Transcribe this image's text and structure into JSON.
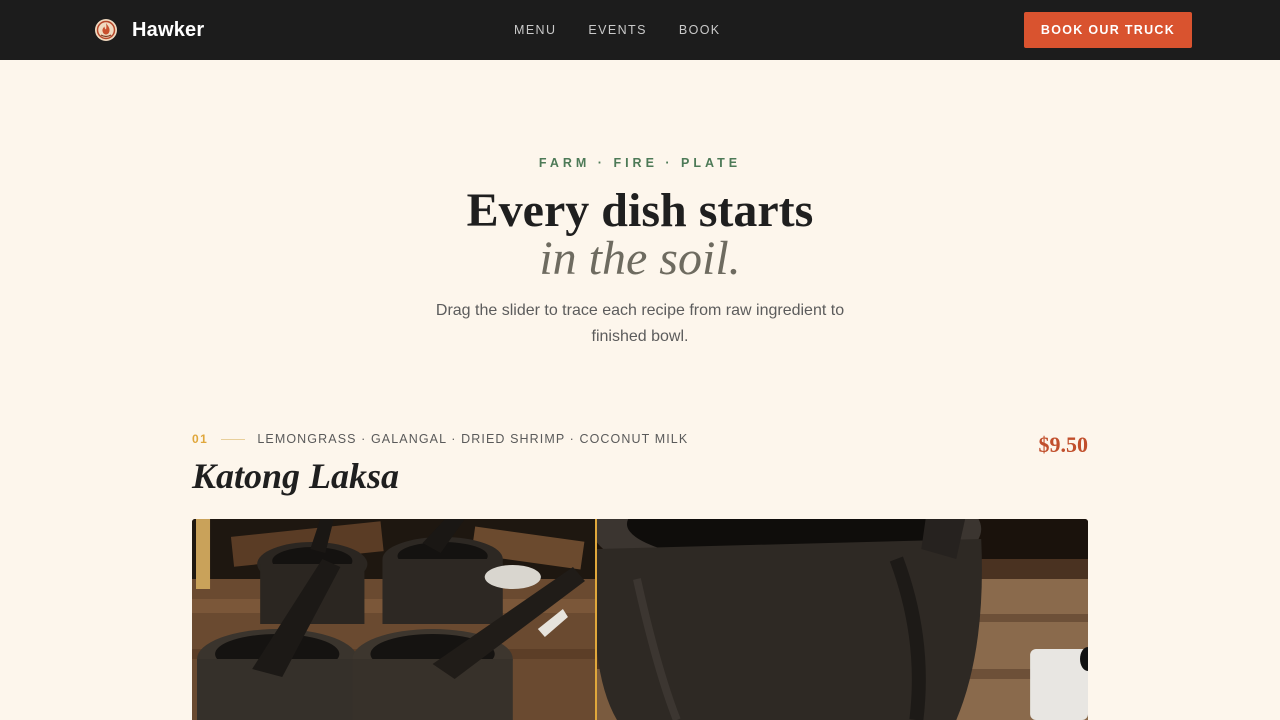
{
  "brand": {
    "name": "Hawker",
    "icon": "flame-bowl-icon"
  },
  "nav": {
    "links": [
      "MENU",
      "EVENTS",
      "BOOK"
    ],
    "cta_label": "BOOK OUR TRUCK"
  },
  "hero": {
    "eyebrow": "FARM · FIRE · PLATE",
    "headline_line1": "Every dish starts",
    "headline_line2": "in the soil.",
    "subtext": "Drag the slider to trace each recipe from raw ingredient to finished bowl."
  },
  "dish": {
    "number": "01",
    "ingredients": "LEMONGRASS · GALANGAL · DRIED SHRIMP · COCONUT MILK",
    "name": "Katong Laksa",
    "price": "$9.50",
    "slider_position": 0.45,
    "left_image": "mortar-and-pestles-photo",
    "right_image": "mortar-closeup-photo"
  },
  "colors": {
    "nav_bg": "#1c1c1c",
    "accent": "#d9532f",
    "eyebrow_green": "#4d7a57",
    "gold": "#e0a73b",
    "price_red": "#c14f2c",
    "page_bg": "#fdf6ec"
  }
}
